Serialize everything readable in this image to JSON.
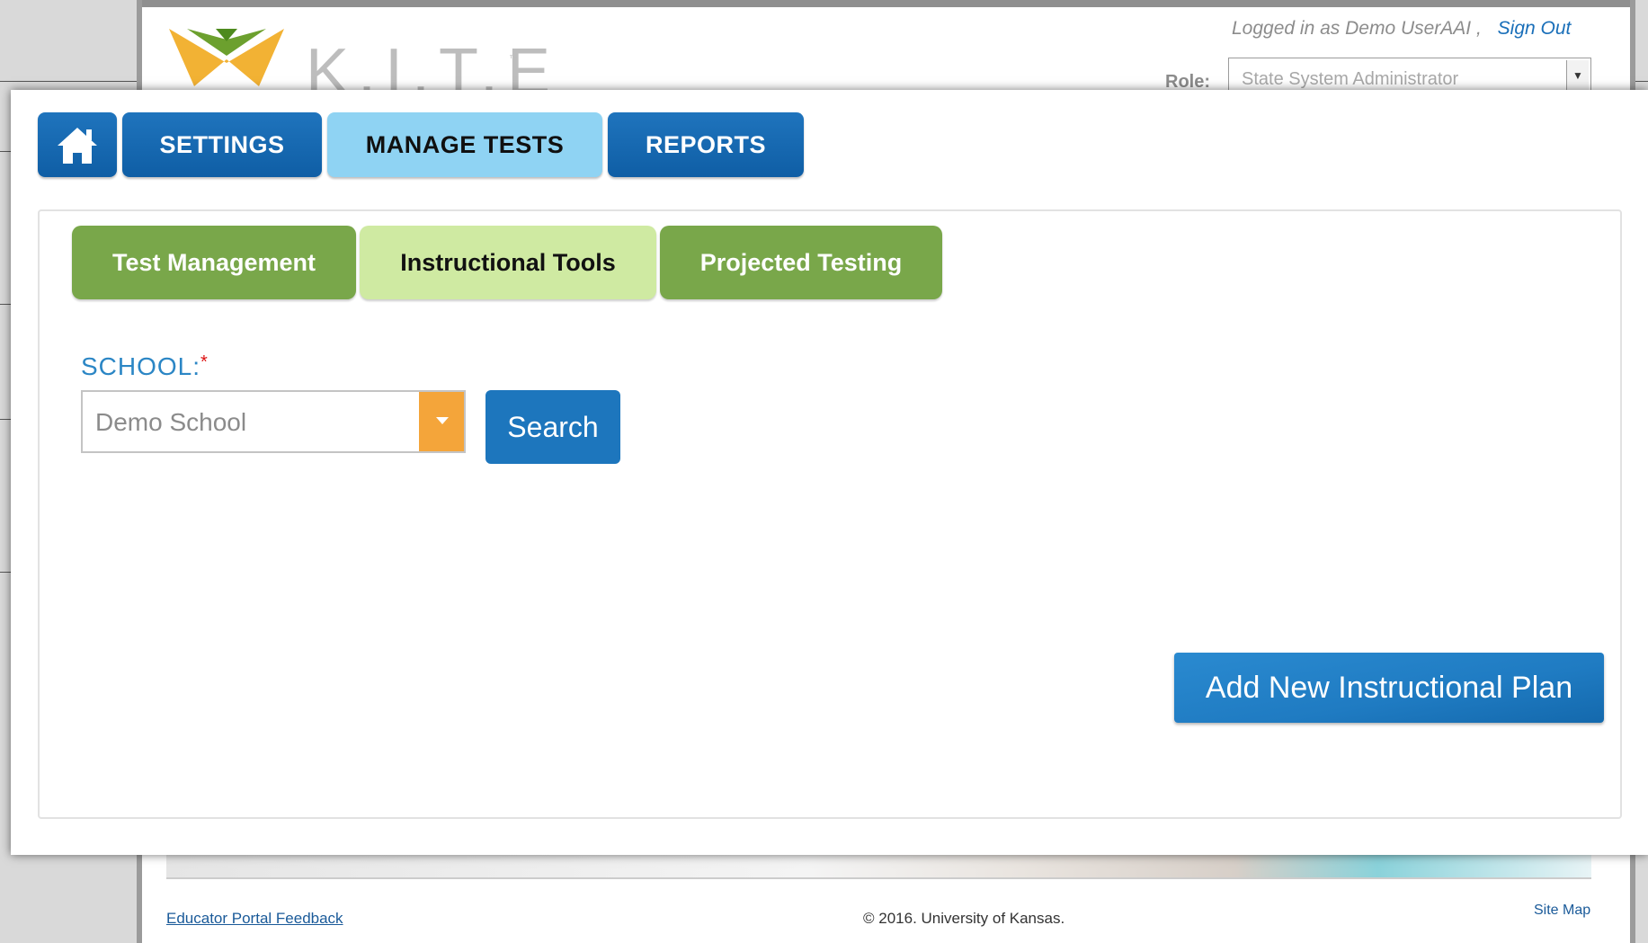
{
  "header": {
    "logo_text": "K.I.T.E",
    "logo_tm": "™",
    "logged_in_text": "Logged in as Demo UserAAI ,",
    "sign_out": "Sign Out",
    "role_label": "Role:",
    "role_value": "State System Administrator"
  },
  "main_nav": {
    "home_icon": "home-icon",
    "items": [
      {
        "label": "SETTINGS",
        "active": false
      },
      {
        "label": "MANAGE TESTS",
        "active": true
      },
      {
        "label": "REPORTS",
        "active": false
      }
    ]
  },
  "sub_tabs": [
    {
      "label": "Test Management",
      "active": false
    },
    {
      "label": "Instructional Tools",
      "active": true
    },
    {
      "label": "Projected Testing",
      "active": false
    }
  ],
  "form": {
    "school_label": "SCHOOL:",
    "required_marker": "*",
    "school_value": "Demo School",
    "search_label": "Search"
  },
  "add_plan_label": "Add New Instructional Plan",
  "footer": {
    "feedback": "Educator Portal Feedback",
    "copyright": "© 2016. University of Kansas.",
    "site_map": "Site Map"
  },
  "colors": {
    "nav_blue": "#1f74bd",
    "nav_active": "#8fd3f3",
    "tab_green": "#79a74a",
    "tab_active": "#cfeaa2",
    "dropdown_orange": "#f4a53a"
  }
}
